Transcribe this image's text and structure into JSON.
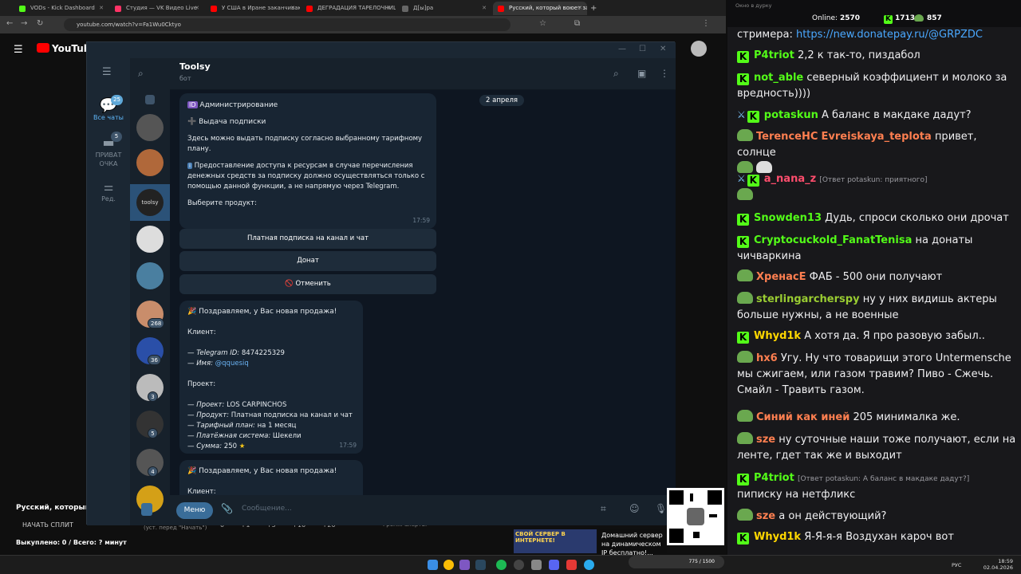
{
  "browser": {
    "tabs": [
      {
        "label": "VODs - Kick Dashboard",
        "color": "#53fc18"
      },
      {
        "label": "Студия — VK Видео Live",
        "color": "#ff3366"
      },
      {
        "label": "У США в Иране заканчивают",
        "color": "#ff0000"
      },
      {
        "label": "ДЕГРАДАЦИЯ ТАРЕЛОЧНИЦ",
        "color": "#ff0000"
      },
      {
        "label": "Д[ы]ра",
        "color": "#666666"
      },
      {
        "label": "Русский, который воюет за Укр",
        "color": "#ff0000"
      }
    ],
    "url": "youtube.com/watch?v=Fa1Wu0Cktyo"
  },
  "youtube": {
    "logo": "YouTube",
    "video_title": "Русский, который вое",
    "split_button": "НАЧАТЬ СПЛИТ",
    "bought": "Выкуплено: 0 / Всего: ? минут",
    "sub_hint": "(уст. перед \"Начать\")",
    "nums": "0 +1 +5 +10 +20",
    "memo": "Громк. алерта:"
  },
  "telegram": {
    "rail": [
      {
        "label": "Все чаты",
        "badge": "25",
        "icon": "chat-bubble-icon"
      },
      {
        "label": "ПРИВАТ ОЧКА",
        "badge": "5",
        "icon": "chat-bubble-icon"
      },
      {
        "label": "Ред.",
        "badge": "",
        "icon": "sliders-icon"
      }
    ],
    "chat_badges": [
      "268",
      "36",
      "3",
      "5",
      "4"
    ],
    "selected_chat_label": "toolsy",
    "chat": {
      "name": "Toolsy",
      "status": "бот"
    },
    "messages": {
      "date": "2 апреля",
      "admin_title": "Администрирование",
      "issue_title": "Выдача подписки",
      "issue_text": "Здесь можно выдать подписку согласно выбранному тарифному плану.",
      "info_text": "Предоставление доступа к ресурсам в случае перечисления денежных средств за подписку должно осуществляться только с помощью данной функции, а не напрямую через Telegram.",
      "choose": "Выберите продукт:",
      "time1": "17:59",
      "buttons": [
        "Платная подписка на канал и чат",
        "Донат",
        "🚫 Отменить"
      ],
      "sale_title": "Поздравляем, у Вас новая продажа!",
      "client_label": "Клиент:",
      "tg_id_label": "— Telegram ID:",
      "tg_id": "8474225329",
      "name_label": "— Имя:",
      "name_value": "@qquesiq",
      "project_label": "Проект:",
      "project_line": "LOS CARPINCHOS",
      "product_line": "Платная подписка на канал и чат",
      "plan_line": "на 1 месяц",
      "pay_line": "Шекели",
      "sum_line": "250",
      "l_project": "— Проект:",
      "l_product": "— Продукт:",
      "l_plan": "— Тарифный план:",
      "l_pay": "— Платёжная система:",
      "l_sum": "— Сумма:",
      "time2": "17:59",
      "sale_title2": "Поздравляем, у Вас новая продажа!",
      "client_label2": "Клиент:"
    },
    "composer": {
      "menu": "Меню",
      "placeholder": "Сообщение..."
    }
  },
  "stream_chat": {
    "window_title": "Окно в дурку",
    "online_label": "Online:",
    "online": "2570",
    "kick_count": "1713",
    "other_count": "857",
    "lines": [
      {
        "user": "",
        "text": "стримера: ",
        "link": "https://new.donatepay.ru/@GRPZDC",
        "color": "#ffffff"
      },
      {
        "user": "P4triot",
        "text": "2,2 к так-то, пиздабол",
        "color": "#53fc18"
      },
      {
        "user": "not_able",
        "text": "северный коэффициент и молоко за вредность))))",
        "color": "#53fc18"
      },
      {
        "user": "potaskun",
        "text": "А баланс в макдаке дадут?",
        "color": "#53fc18"
      },
      {
        "user": "TerenceHC",
        "user2": "Evreiskaya_teplota",
        "text": "привет, солнце",
        "color": "#ff7f50"
      },
      {
        "user": "a_nana_z",
        "reply": "[Ответ potaskun: приятного]",
        "text": "",
        "color": "#ff4d6d"
      },
      {
        "user": "Snowden13",
        "text": "Дудь, спроси сколько они дрочат",
        "color": "#53fc18"
      },
      {
        "user": "Cryptocuckold_FanatTenisa",
        "text": "на донаты чичваркина",
        "color": "#53fc18"
      },
      {
        "user": "ХренасЕ",
        "text": "ФАБ - 500 они получают",
        "color": "#ff7f50"
      },
      {
        "user": "sterlingarchersру",
        "text": "ну у них видишь актеры больше нужны, а не военные",
        "color": "#9acd32"
      },
      {
        "user": "Whyd1k",
        "text": "А хотя да. Я про разовую забыл..",
        "color": "#ffd700"
      },
      {
        "user": "hx6",
        "text": "Угу. Ну что товарищи этого Untermensche мы сжигаем, или газом травим? Пиво - Сжечь. Смайл - Травить газом.",
        "color": "#ff7f50"
      },
      {
        "user": "Синий как иней",
        "text": "205 минималка же.",
        "color": "#ff7f50"
      },
      {
        "user": "sze",
        "text": "ну суточные наши тоже получают, если на ленте, гдет так же и выходит",
        "color": "#ff7f50"
      },
      {
        "user": "P4triot",
        "reply": "[Ответ potaskun: А баланс в макдаке дадут?]",
        "text": "пиписку на нетфликс",
        "color": "#53fc18"
      },
      {
        "user": "sze",
        "text": "а он действующий?",
        "color": "#ff7f50"
      },
      {
        "user": "Whyd1k",
        "text": "Я-Я-я-я Воздухан кароч вот",
        "color": "#ffd700"
      }
    ]
  },
  "ads": {
    "server": "СВОЙ СЕРВЕР В ИНТЕРНЕТЕ!",
    "home": "Домашний сервер на динамическом IP бесплатно!...",
    "donation_bar": "775 / 1500"
  },
  "taskbar": {
    "lang": "РУС",
    "time": "18:59",
    "date": "02.04.2026"
  }
}
